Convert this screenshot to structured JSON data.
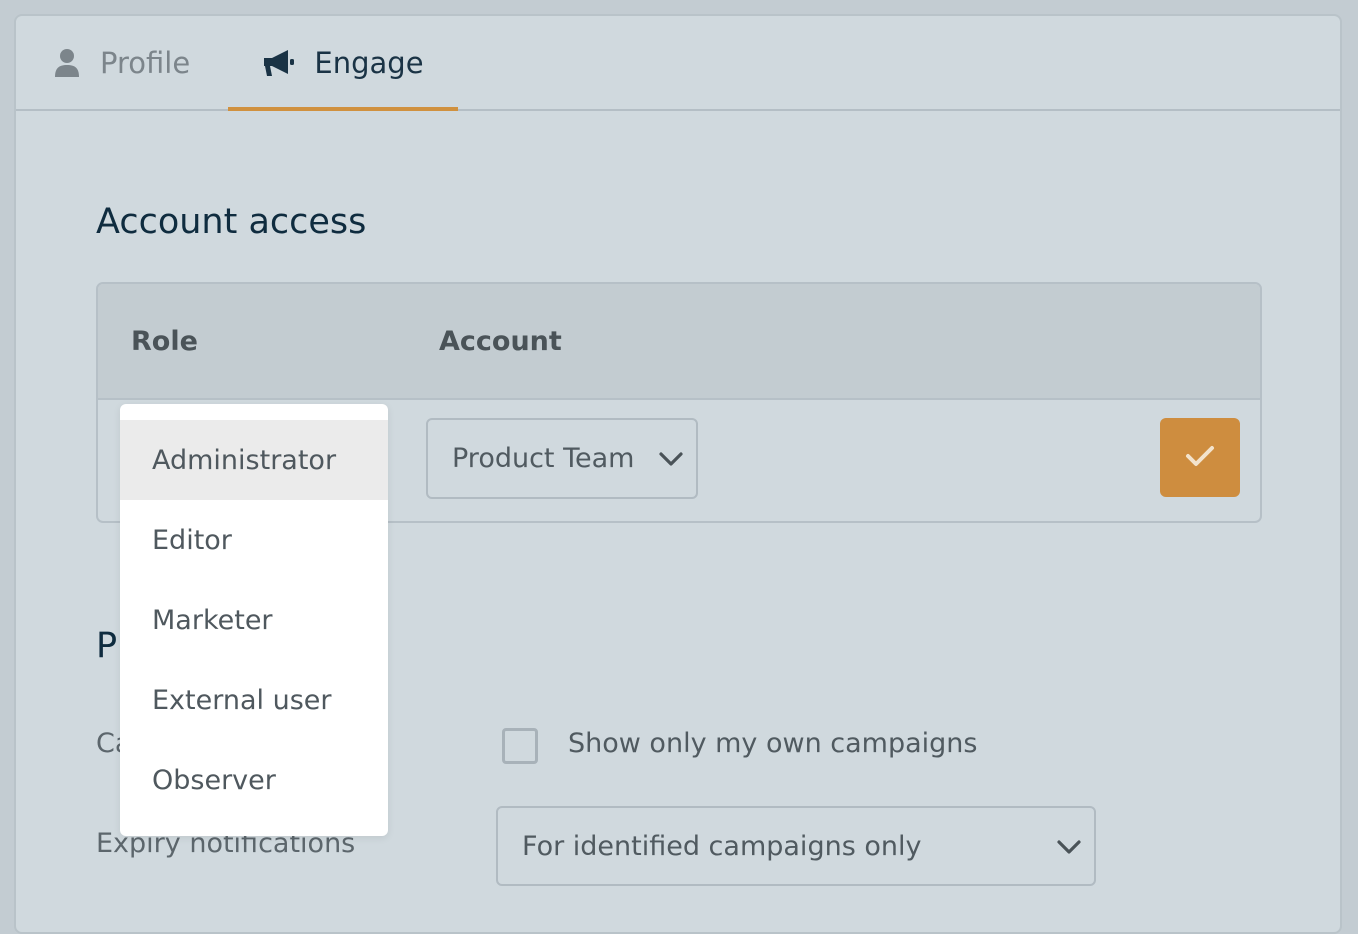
{
  "tabs": [
    {
      "label": "Profile",
      "icon": "user-icon",
      "active": false
    },
    {
      "label": "Engage",
      "icon": "megaphone-icon",
      "active": true
    }
  ],
  "account_access": {
    "title": "Account access",
    "columns": [
      "Role",
      "Account"
    ],
    "account_value": "Product Team",
    "confirm_icon": "checkmark-icon"
  },
  "role_dropdown": {
    "options": [
      "Administrator",
      "Editor",
      "Marketer",
      "External user",
      "Observer"
    ],
    "highlighted": "Administrator"
  },
  "preferences": {
    "title_partial": "P",
    "campaigns_label_partial": "Ca",
    "show_own_label": "Show only my own campaigns",
    "show_own_checked": false,
    "expiry_label": "Expiry notifications",
    "expiry_value": "For identified campaigns only"
  },
  "colors": {
    "accent": "#d0913f",
    "confirm_button": "#ce8d3f",
    "heading": "#0f2c3f",
    "panel_bg": "#d0d9de"
  }
}
